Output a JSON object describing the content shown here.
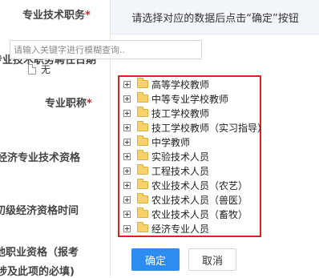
{
  "form": {
    "labels": [
      {
        "text": "专业技术职务",
        "required": true
      },
      {
        "text": "专业技术职务聘任日期",
        "required": false
      },
      {
        "text": "专业职称",
        "required": true
      },
      {
        "text": "经济专业技术资格",
        "required": false
      },
      {
        "text": "初级经济资格时间",
        "required": false
      },
      {
        "text": "他职业资格（报考",
        "required": false
      },
      {
        "text": "涉及此项的必填)",
        "required": false
      }
    ]
  },
  "dialog": {
    "header": "请选择对应的数据后点击“确定”按钮",
    "search_placeholder": "请输入关键字进行模糊查询..",
    "root_label": "无",
    "items": [
      "高等学校教师",
      "中等专业学校教师",
      "技工学校教师",
      "技工学校教师（实习指导）",
      "中学教师",
      "实验技术人员",
      "工程技术人员",
      "农业技术人员（农艺）",
      "农业技术人员（兽医）",
      "农业技术人员（畜牧）",
      "经济专业人员"
    ],
    "confirm_label": "确定",
    "cancel_label": "取消"
  },
  "colors": {
    "accent": "#2d8cf0",
    "highlight_border": "#e02020",
    "required": "#e02020",
    "header_bg": "#f2f6fb",
    "folder": "#f5d26b"
  }
}
